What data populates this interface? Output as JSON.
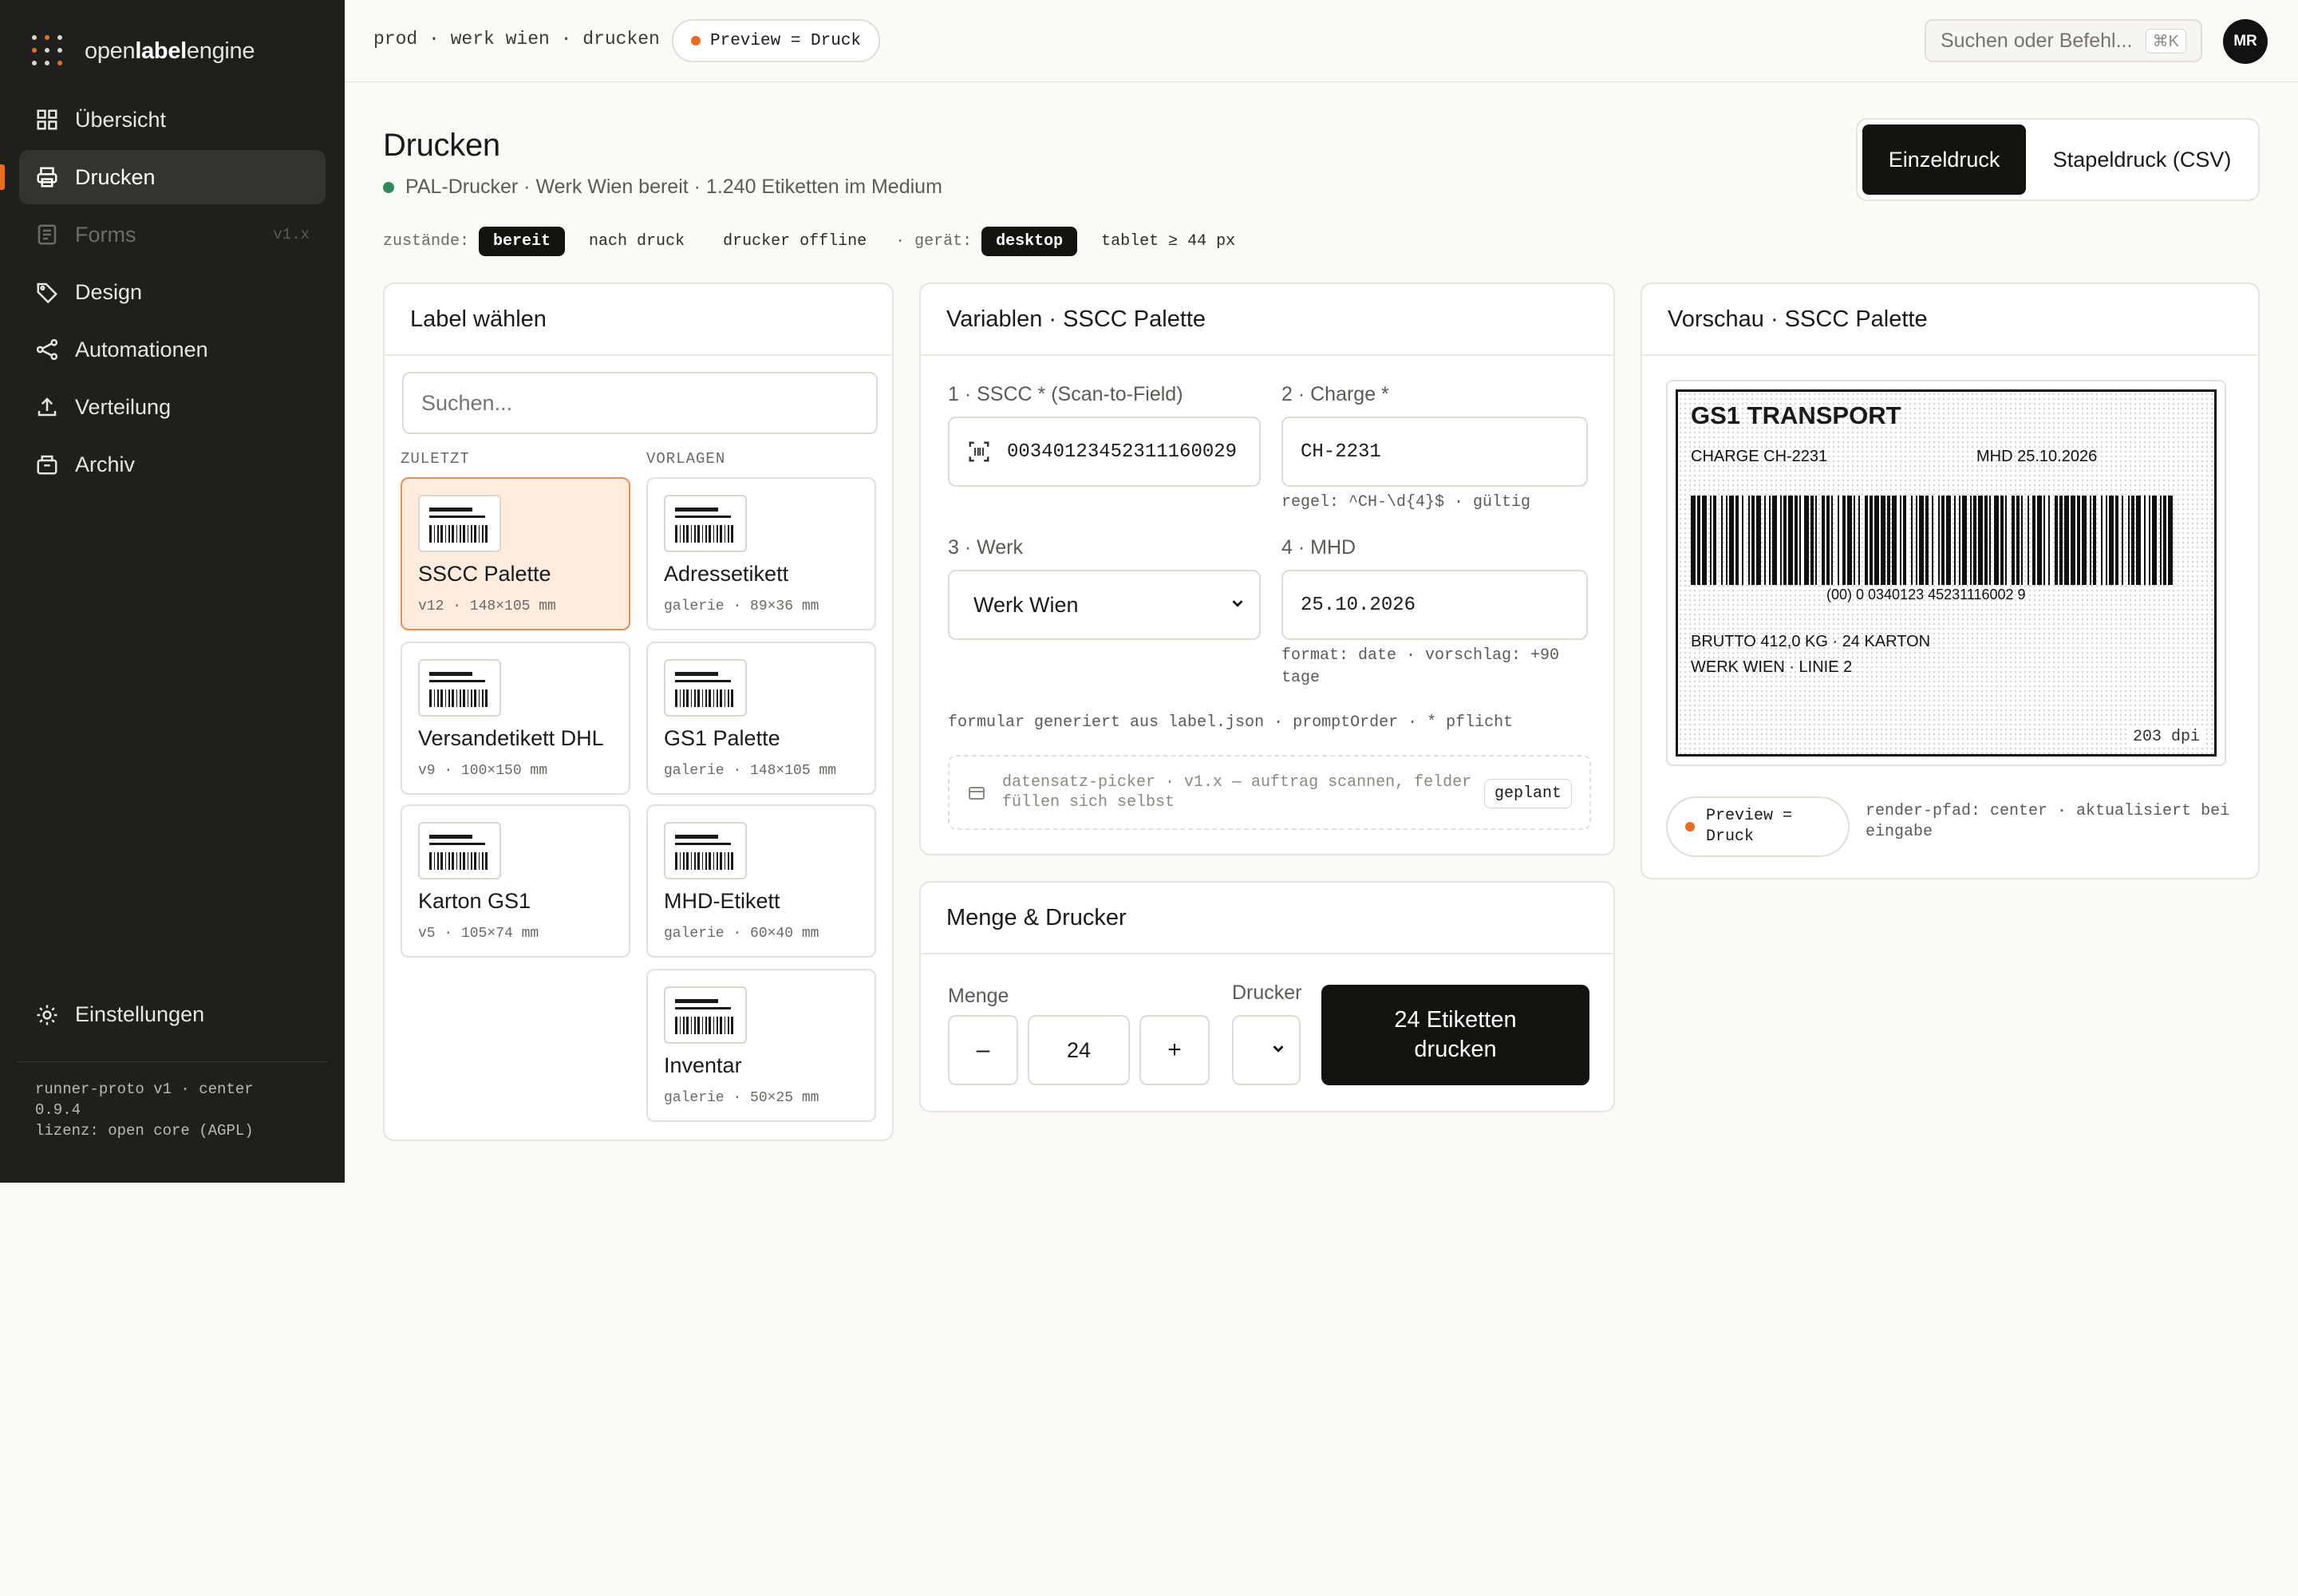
{
  "brand": {
    "prefix": "open",
    "bold": "label",
    "suffix": "engine"
  },
  "nav": [
    {
      "label": "Übersicht",
      "icon": "grid-icon"
    },
    {
      "label": "Drucken",
      "icon": "printer-icon",
      "active": true
    },
    {
      "label": "Forms",
      "icon": "form-icon",
      "version": "v1.x",
      "disabled": true
    },
    {
      "label": "Design",
      "icon": "tag-icon"
    },
    {
      "label": "Automationen",
      "icon": "share-icon"
    },
    {
      "label": "Verteilung",
      "icon": "upload-icon"
    },
    {
      "label": "Archiv",
      "icon": "archive-icon"
    }
  ],
  "settings_label": "Einstellungen",
  "footer": {
    "line1": "runner-proto v1 · center 0.9.4",
    "line2": "lizenz: open core (AGPL)"
  },
  "topbar": {
    "breadcrumb": "prod · werk wien · drucken",
    "preview_pill": "Preview = Druck",
    "search_placeholder": "Suchen oder Befehl...",
    "search_shortcut": "⌘K",
    "avatar": "MR"
  },
  "header": {
    "title": "Drucken",
    "status": "PAL-Drucker · Werk Wien bereit · 1.240 Etiketten im Medium",
    "mode_single": "Einzeldruck",
    "mode_batch": "Stapeldruck (CSV)"
  },
  "states": {
    "label": "zustände:",
    "items": [
      "bereit",
      "nach druck",
      "drucker offline"
    ],
    "device_label": "· gerät:",
    "devices": [
      "desktop",
      "tablet ≥ 44 px"
    ]
  },
  "picker": {
    "title": "Label wählen",
    "search_placeholder": "Suchen...",
    "recent_header": "ZULETZT",
    "templates_header": "VORLAGEN",
    "recent": [
      {
        "name": "SSCC Palette",
        "meta": "v12 · 148×105 mm",
        "selected": true
      },
      {
        "name": "Versandetikett DHL",
        "meta": "v9 · 100×150 mm"
      },
      {
        "name": "Karton GS1",
        "meta": "v5 · 105×74 mm"
      }
    ],
    "templates": [
      {
        "name": "Adressetikett",
        "meta": "galerie · 89×36 mm"
      },
      {
        "name": "GS1 Palette",
        "meta": "galerie · 148×105 mm"
      },
      {
        "name": "MHD-Etikett",
        "meta": "galerie · 60×40 mm"
      },
      {
        "name": "Inventar",
        "meta": "galerie · 50×25 mm"
      }
    ]
  },
  "variables": {
    "title": "Variablen · SSCC Palette",
    "sscc_label": "1 · SSCC * (Scan-to-Field)",
    "sscc_value": "00340123452311160029",
    "charge_label": "2 · Charge *",
    "charge_value": "CH-2231",
    "charge_hint": "regel: ^CH-\\d{4}$ · gültig",
    "werk_label": "3 · Werk",
    "werk_value": "Werk Wien",
    "mhd_label": "4 · MHD",
    "mhd_value": "25.10.2026",
    "mhd_hint": "format: date · vorschlag: +90 tage",
    "form_note": "formular generiert aus label.json · promptOrder · * pflicht",
    "planned_text": "datensatz-picker · v1.x — auftrag scannen, felder füllen sich selbst",
    "planned_badge": "geplant"
  },
  "quantity": {
    "title": "Menge & Drucker",
    "menge_label": "Menge",
    "menge_value": "24",
    "minus": "–",
    "plus": "+",
    "drucker_label": "Drucker",
    "print_button": "24 Etiketten drucken"
  },
  "preview": {
    "title": "Vorschau · SSCC Palette",
    "label_title": "GS1 TRANSPORT",
    "charge": "CHARGE CH-2231",
    "mhd": "MHD 25.10.2026",
    "barcode_text": "(00) 0 0340123 45231116002 9",
    "brutto": "BRUTTO 412,0 KG · 24 KARTON",
    "werk": "WERK WIEN · LINIE 2",
    "dpi": "203 dpi",
    "pill": "Preview = Druck",
    "note": "render-pfad: center · aktualisiert bei eingabe"
  },
  "colors": {
    "accent": "#ef6a1a",
    "sidebar": "#1f1f1b",
    "ok": "#2e8b57",
    "dark": "#131310"
  }
}
